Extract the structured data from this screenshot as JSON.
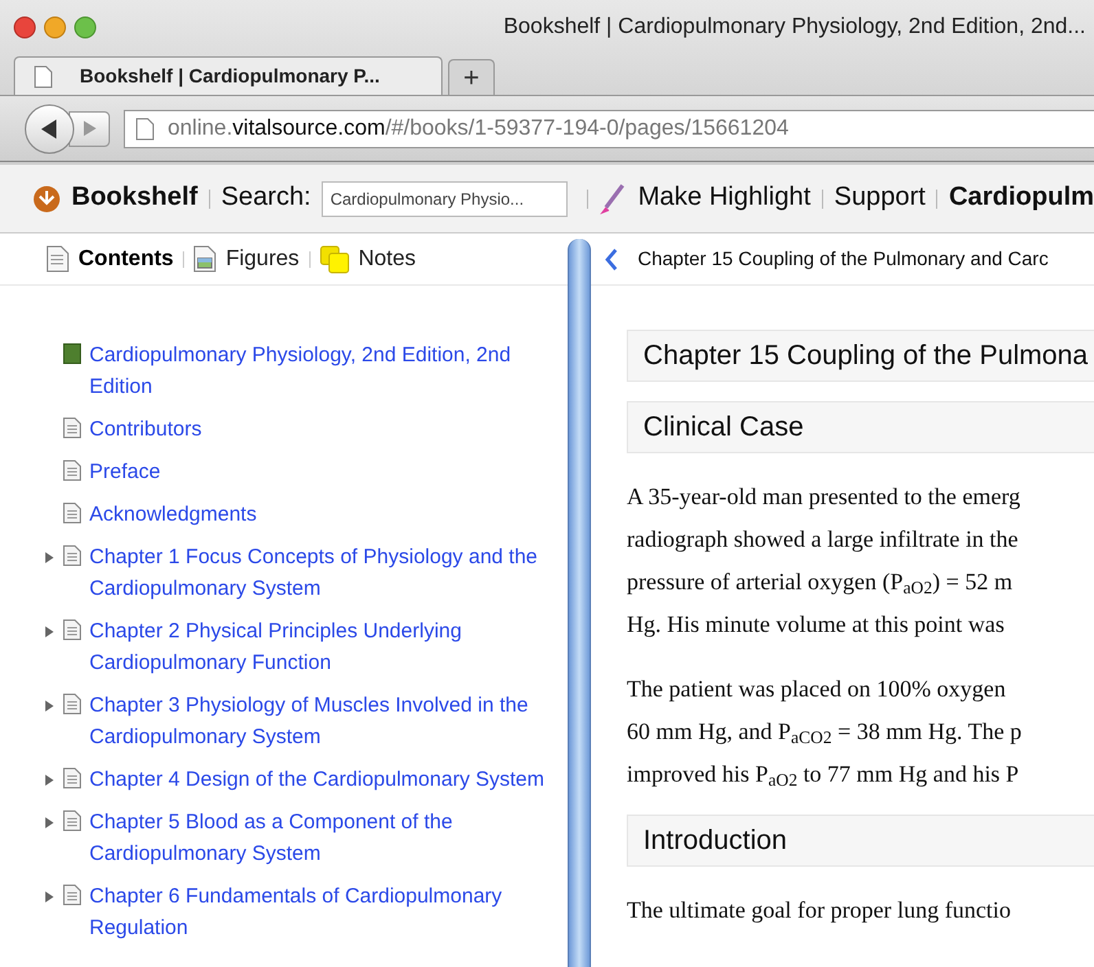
{
  "window": {
    "title": "Bookshelf | Cardiopulmonary Physiology, 2nd Edition, 2nd..."
  },
  "tabs": [
    {
      "label": "Bookshelf | Cardiopulmonary P...",
      "selected": true
    }
  ],
  "new_tab": "+",
  "address": {
    "host_prefix": "online.",
    "host": "vitalsource.com",
    "path": "/#/books/1-59377-194-0/pages/15661204"
  },
  "toolbar": {
    "home": "Bookshelf",
    "search_label": "Search:",
    "search_value": "Cardiopulmonary Physio...",
    "highlight": "Make Highlight",
    "support": "Support",
    "book_title": "Cardiopulm"
  },
  "sidebar": {
    "tabs": [
      {
        "label": "Contents",
        "selected": true,
        "kind": "page"
      },
      {
        "label": "Figures",
        "selected": false,
        "kind": "figure"
      },
      {
        "label": "Notes",
        "selected": false,
        "kind": "note"
      }
    ],
    "items": [
      {
        "kind": "book",
        "label": "Cardiopulmonary Physiology, 2nd Edition, 2nd Edition"
      },
      {
        "kind": "page",
        "label": "Contributors"
      },
      {
        "kind": "page",
        "label": "Preface"
      },
      {
        "kind": "page",
        "label": "Acknowledgments"
      },
      {
        "kind": "chapter",
        "expanded": false,
        "label": "Chapter 1 Focus Concepts of Physiology and the Cardiopulmonary System"
      },
      {
        "kind": "chapter",
        "expanded": false,
        "label": "Chapter 2 Physical Principles Underlying Cardiopulmonary Function"
      },
      {
        "kind": "chapter",
        "expanded": false,
        "label": "Chapter 3 Physiology of Muscles Involved in the Cardiopulmonary System"
      },
      {
        "kind": "chapter",
        "expanded": false,
        "label": "Chapter 4 Design of the Cardiopulmonary System"
      },
      {
        "kind": "chapter",
        "expanded": false,
        "label": "Chapter 5 Blood as a Component of the Cardiopulmonary System"
      },
      {
        "kind": "chapter",
        "expanded": false,
        "label": "Chapter 6 Fundamentals of Cardiopulmonary Regulation"
      }
    ]
  },
  "reader": {
    "breadcrumb": "Chapter 15 Coupling of the Pulmonary and Carc",
    "blocks": [
      {
        "kind": "heading",
        "text": "Chapter 15 Coupling of the Pulmona"
      },
      {
        "kind": "heading",
        "text": "Clinical Case"
      },
      {
        "kind": "paragraph",
        "lines": [
          "A 35-year-old man presented to the emerg",
          "radiograph showed a large infiltrate in the",
          "pressure of arterial oxygen (P$_{aO}$$_{2}$) = 52 m",
          "Hg. His minute volume at this point was"
        ]
      },
      {
        "kind": "paragraph",
        "lines": [
          "The patient was placed on 100% oxygen",
          "60 mm Hg, and P$_{aCO}$$_{2}$ = 38 mm Hg. The p",
          "improved his P$_{aO}$$_{2}$ to 77 mm Hg and his P"
        ]
      },
      {
        "kind": "heading",
        "text": "Introduction"
      },
      {
        "kind": "paragraph",
        "lines": [
          "The ultimate goal for proper lung functio"
        ]
      }
    ]
  }
}
